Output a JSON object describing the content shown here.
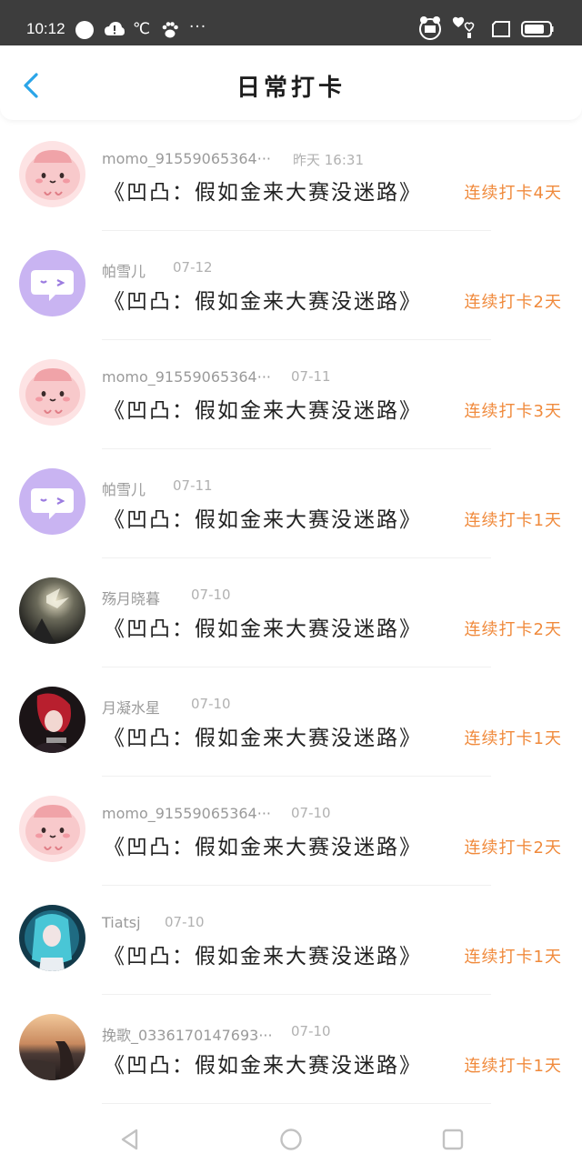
{
  "status_bar": {
    "time": "10:12",
    "temp_unit": "℃",
    "more": "···",
    "icons": [
      "chat-bubble-icon",
      "cloud-alert-icon",
      "paw-icon",
      "app-badge-icon",
      "heart-app-icon",
      "sim-icon",
      "battery-icon"
    ]
  },
  "header": {
    "title": "日常打卡",
    "back_icon": "chevron-left-icon"
  },
  "colors": {
    "accent": "#2aa5e8",
    "streak": "#f08a3c",
    "status_bar_bg": "#3d3d3d"
  },
  "entries": [
    {
      "name": "momo_91559065364···",
      "date": "昨天 16:31",
      "content": "《凹凸：假如金来大赛没迷路》",
      "streak": "连续打卡4天",
      "avatar": "pink-blob-avatar"
    },
    {
      "name": "帕雪儿",
      "date": "07-12",
      "content": "《凹凸：假如金来大赛没迷路》",
      "streak": "连续打卡2天",
      "avatar": "purple-chat-avatar"
    },
    {
      "name": "momo_91559065364···",
      "date": "07-11",
      "content": "《凹凸：假如金来大赛没迷路》",
      "streak": "连续打卡3天",
      "avatar": "pink-blob-avatar"
    },
    {
      "name": "帕雪儿",
      "date": "07-11",
      "content": "《凹凸：假如金来大赛没迷路》",
      "streak": "连续打卡1天",
      "avatar": "purple-chat-avatar"
    },
    {
      "name": "殇月晓暮",
      "date": "07-10",
      "content": "《凹凸：假如金来大赛没迷路》",
      "streak": "连续打卡2天",
      "avatar": "photo-avatar"
    },
    {
      "name": "月凝水星",
      "date": "07-10",
      "content": "《凹凸：假如金来大赛没迷路》",
      "streak": "连续打卡1天",
      "avatar": "photo-avatar"
    },
    {
      "name": "momo_91559065364···",
      "date": "07-10",
      "content": "《凹凸：假如金来大赛没迷路》",
      "streak": "连续打卡2天",
      "avatar": "pink-blob-avatar"
    },
    {
      "name": "Tiatsj",
      "date": "07-10",
      "content": "《凹凸：假如金来大赛没迷路》",
      "streak": "连续打卡1天",
      "avatar": "photo-avatar"
    },
    {
      "name": "挽歌_0336170147693···",
      "date": "07-10",
      "content": "《凹凸：假如金来大赛没迷路》",
      "streak": "连续打卡1天",
      "avatar": "photo-avatar"
    }
  ],
  "nav_bar": {
    "buttons": [
      "back-triangle-icon",
      "home-circle-icon",
      "recents-square-icon"
    ]
  }
}
